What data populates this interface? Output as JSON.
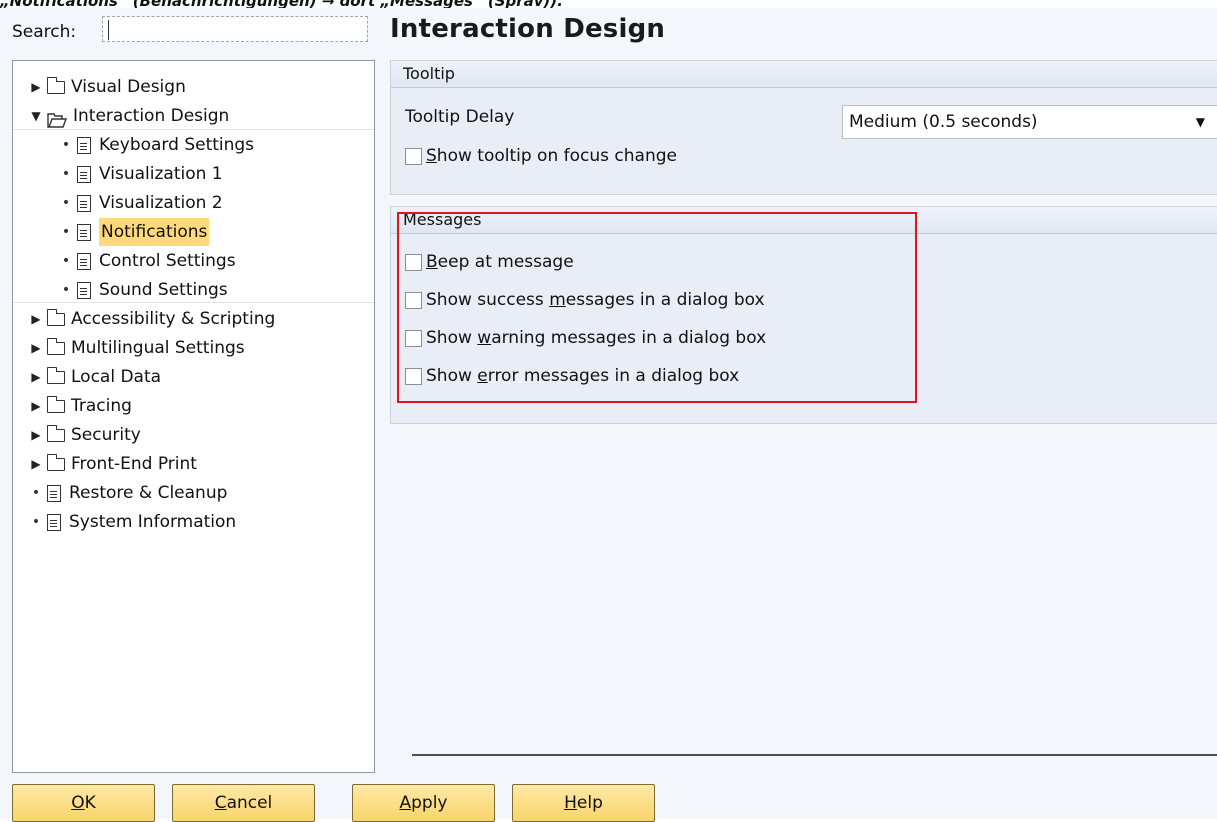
{
  "caption": {
    "text": "„Notifications“ (Benachrichtigungen) → dort „Messages“ (Sprav))."
  },
  "search": {
    "label": "Search:",
    "value": ""
  },
  "page_title": "Interaction Design",
  "tree": {
    "items": [
      {
        "label": "Visual Design",
        "type": "folder",
        "state": "collapsed"
      },
      {
        "label": "Interaction Design",
        "type": "folder",
        "state": "expanded"
      },
      {
        "label": "Keyboard Settings",
        "type": "doc"
      },
      {
        "label": "Visualization 1",
        "type": "doc"
      },
      {
        "label": "Visualization 2",
        "type": "doc"
      },
      {
        "label": "Notifications",
        "type": "doc",
        "selected": true
      },
      {
        "label": "Control Settings",
        "type": "doc"
      },
      {
        "label": "Sound Settings",
        "type": "doc"
      },
      {
        "label": "Accessibility & Scripting",
        "type": "folder",
        "state": "collapsed"
      },
      {
        "label": "Multilingual Settings",
        "type": "folder",
        "state": "collapsed"
      },
      {
        "label": "Local Data",
        "type": "folder",
        "state": "collapsed"
      },
      {
        "label": "Tracing",
        "type": "folder",
        "state": "collapsed"
      },
      {
        "label": "Security",
        "type": "folder",
        "state": "collapsed"
      },
      {
        "label": "Front-End Print",
        "type": "folder",
        "state": "collapsed"
      },
      {
        "label": "Restore & Cleanup",
        "type": "doc"
      },
      {
        "label": "System Information",
        "type": "doc"
      }
    ]
  },
  "tooltip_group": {
    "title": "Tooltip",
    "delay_label": "Tooltip Delay",
    "delay_value": "Medium (0.5 seconds)",
    "focus_change_pre": "",
    "focus_change_key": "S",
    "focus_change_post": "how tooltip on focus change",
    "focus_change_checked": false
  },
  "messages_group": {
    "title": "Messages",
    "beep_key": "B",
    "beep_post": "eep at message",
    "success_pre": "Show success ",
    "success_key": "m",
    "success_post": "essages in a dialog box",
    "warning_pre": "Show ",
    "warning_key": "w",
    "warning_post": "arning messages in a dialog box",
    "error_pre": "Show ",
    "error_key": "e",
    "error_post": "rror messages in a dialog box"
  },
  "buttons": {
    "ok_key": "O",
    "ok_post": "K",
    "cancel_key": "C",
    "cancel_post": "ancel",
    "apply_key": "A",
    "apply_post": "pply",
    "help_key": "H",
    "help_post": "elp"
  },
  "colors": {
    "selection": "#ffd97a",
    "highlight_box": "#e0161c",
    "button": "#f7d46c"
  }
}
